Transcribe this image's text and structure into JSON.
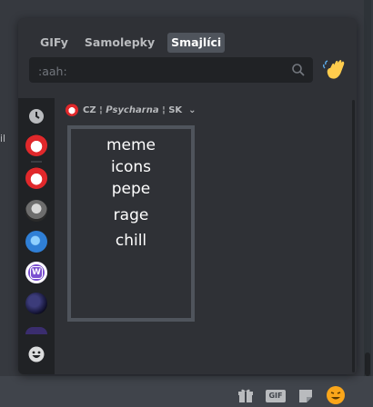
{
  "chat": {
    "peek_text": "il"
  },
  "tabs": [
    {
      "label": "GIFy",
      "active": false
    },
    {
      "label": "Samolepky",
      "active": false
    },
    {
      "label": "Smajlíci",
      "active": true
    }
  ],
  "search": {
    "value": "",
    "placeholder": ":aah:"
  },
  "section": {
    "title": "CZ ¦ 𝙋𝙨𝙮𝙘𝙝𝙖𝙧𝙣𝙖 ¦ SK",
    "chevron": "⌄"
  },
  "emoji_words": [
    "meme",
    "icons",
    "pepe",
    "rage",
    "chill"
  ],
  "colors": {
    "accent": "#5865f2",
    "popout_bg": "#2f3136",
    "sidebar_bg": "#202225"
  },
  "icons": {
    "search": "search-icon",
    "wave": "waving-hand-icon",
    "recent": "clock-icon",
    "footer": "smiley-icon",
    "gift": "gift-icon",
    "gif": "gif-icon",
    "sticker": "sticker-icon",
    "emoji": "emoji-icon"
  },
  "bar": {
    "gif_label": "GIF"
  }
}
